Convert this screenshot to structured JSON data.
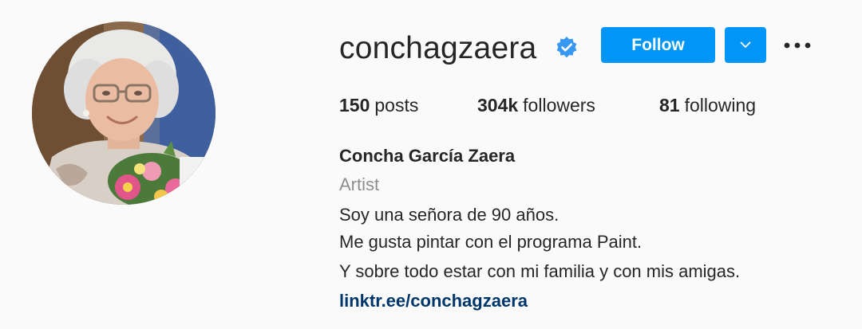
{
  "profile": {
    "username": "conchagzaera",
    "verified": true,
    "avatar_icon": "profile-photo",
    "follow_label": "Follow",
    "dropdown_icon": "chevron-down-icon",
    "more_icon": "more-horizontal-icon"
  },
  "stats": {
    "posts_count": "150",
    "posts_label": "posts",
    "followers_count": "304k",
    "followers_label": "followers",
    "following_count": "81",
    "following_label": "following"
  },
  "bio": {
    "full_name": "Concha García Zaera",
    "category": "Artist",
    "lines": [
      "Soy una señora de 90 años.",
      "Me gusta pintar con el programa Paint.",
      "Y sobre todo estar con mi familia y con mis amigas."
    ],
    "link": "linktr.ee/conchagzaera"
  },
  "colors": {
    "background": "#fafafa",
    "accent": "#0095f6",
    "verified": "#3897f0",
    "muted_text": "#8e8e8e",
    "link": "#00376b",
    "text": "#262626"
  }
}
